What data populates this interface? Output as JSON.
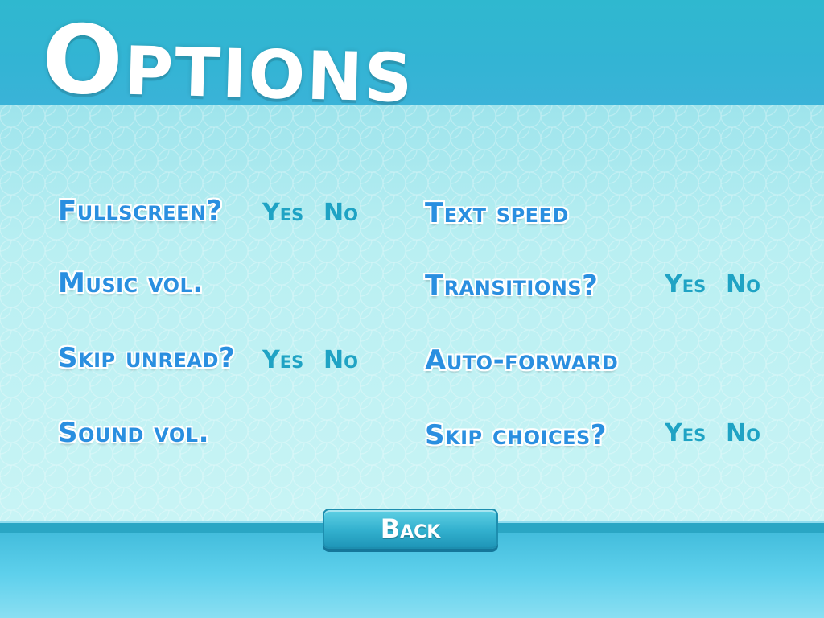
{
  "screen": {
    "title": "Options"
  },
  "left_column": [
    {
      "label": "Fullscreen?",
      "yes": "Yes",
      "no": "No"
    },
    {
      "label": "Music vol."
    },
    {
      "label": "Skip unread?",
      "yes": "Yes",
      "no": "No"
    },
    {
      "label": "Sound vol."
    }
  ],
  "right_column": [
    {
      "label": "Text speed"
    },
    {
      "label": "Transitions?",
      "yes": "Yes",
      "no": "No"
    },
    {
      "label": "Auto-forward"
    },
    {
      "label": "Skip choices?",
      "yes": "Yes",
      "no": "No"
    }
  ],
  "back_button": {
    "label": "Back"
  },
  "colors": {
    "label_blue": "#2a8fe0",
    "option_teal": "#1fa3c4",
    "title_white": "#ffffff",
    "band_cyan": "#33b4d4"
  }
}
